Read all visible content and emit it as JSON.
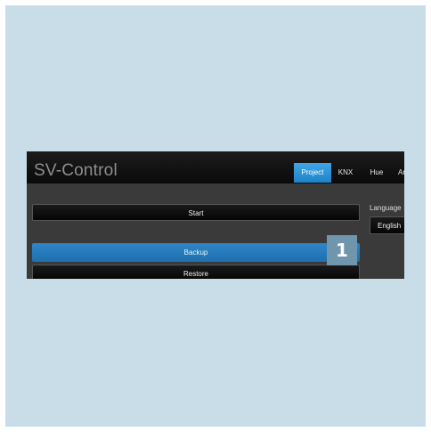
{
  "app": {
    "title": "SV-Control"
  },
  "tabs": [
    {
      "label": "Project",
      "active": true
    },
    {
      "label": "KNX",
      "active": false
    },
    {
      "label": "Hue",
      "active": false
    },
    {
      "label": "Ar",
      "active": false
    }
  ],
  "actions": {
    "start_label": "Start",
    "backup_label": "Backup",
    "restore_label": "Restore"
  },
  "language": {
    "label": "Language",
    "selected": "English"
  },
  "callout": {
    "number": "1"
  },
  "colors": {
    "background": "#c8dde7",
    "accent_active_tab": "#2b95d8",
    "selected_button": "#2578b8",
    "callout": "#6f96ad"
  }
}
